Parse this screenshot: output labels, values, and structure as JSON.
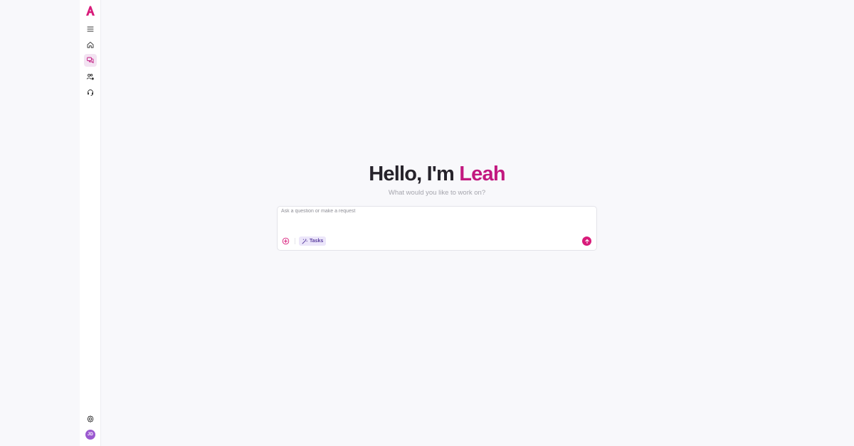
{
  "app": {
    "brand_color": "#d81b7a"
  },
  "sidebar": {
    "items": [
      {
        "id": "menu",
        "icon": "hamburger-menu-icon"
      },
      {
        "id": "home",
        "icon": "home-icon"
      },
      {
        "id": "chats",
        "icon": "chat-bubbles-icon",
        "active": true
      },
      {
        "id": "people",
        "icon": "people-settings-icon"
      },
      {
        "id": "support",
        "icon": "headset-icon"
      }
    ],
    "bottom": [
      {
        "id": "settings",
        "icon": "gear-icon"
      }
    ],
    "avatar": {
      "initials": "JD",
      "color": "#9b59d0"
    }
  },
  "main": {
    "greeting": {
      "prefix": "Hello, I'm ",
      "name": "Leah"
    },
    "subtitle": "What would you like to work on?",
    "composer": {
      "placeholder": "Ask a question or make a request",
      "value": "",
      "tasks_label": "Tasks"
    }
  }
}
